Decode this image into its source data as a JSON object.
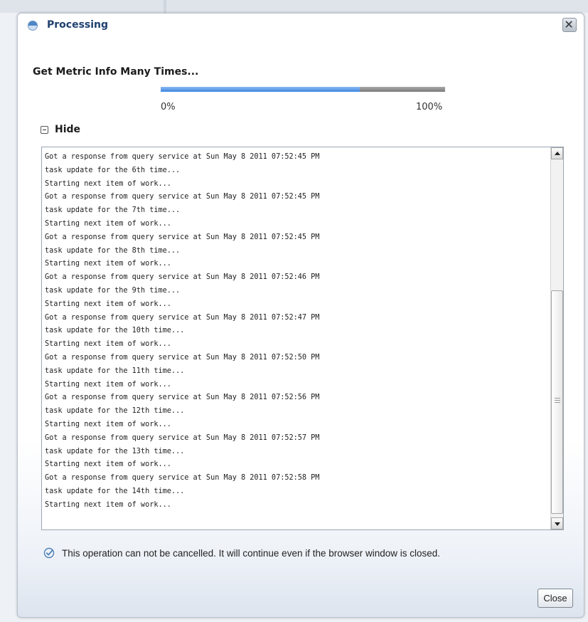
{
  "dialog": {
    "title": "Processing",
    "task_title": "Get Metric Info Many Times...",
    "progress": {
      "fraction": 0.7,
      "min_label": "0%",
      "max_label": "100%"
    },
    "toggle_label": "Hide",
    "log_lines": [
      "Got a response from query service at Sun May 8 2011 07:52:45 PM",
      "task update for the 6th time...",
      "Starting next item of work...",
      "Got a response from query service at Sun May 8 2011 07:52:45 PM",
      "task update for the 7th time...",
      "Starting next item of work...",
      "Got a response from query service at Sun May 8 2011 07:52:45 PM",
      "task update for the 8th time...",
      "Starting next item of work...",
      "Got a response from query service at Sun May 8 2011 07:52:46 PM",
      "task update for the 9th time...",
      "Starting next item of work...",
      "Got a response from query service at Sun May 8 2011 07:52:47 PM",
      "task update for the 10th time...",
      "Starting next item of work...",
      "Got a response from query service at Sun May 8 2011 07:52:50 PM",
      "task update for the 11th time...",
      "Starting next item of work...",
      "Got a response from query service at Sun May 8 2011 07:52:56 PM",
      "task update for the 12th time...",
      "Starting next item of work...",
      "Got a response from query service at Sun May 8 2011 07:52:57 PM",
      "task update for the 13th time...",
      "Starting next item of work...",
      "Got a response from query service at Sun May 8 2011 07:52:58 PM",
      "task update for the 14th time...",
      "Starting next item of work..."
    ],
    "notice": "This operation can not be cancelled.  It will continue even if the browser window is closed.",
    "close_button_label": "Close"
  },
  "icons": {
    "title": "processing-spinner-icon",
    "close": "close-x-icon",
    "toggle": "collapse-minus-icon",
    "notice": "check-circle-icon"
  },
  "colors": {
    "title": "#1f3f6e",
    "progress_fill": "#3d86e0",
    "progress_track": "#7b7b7b"
  }
}
